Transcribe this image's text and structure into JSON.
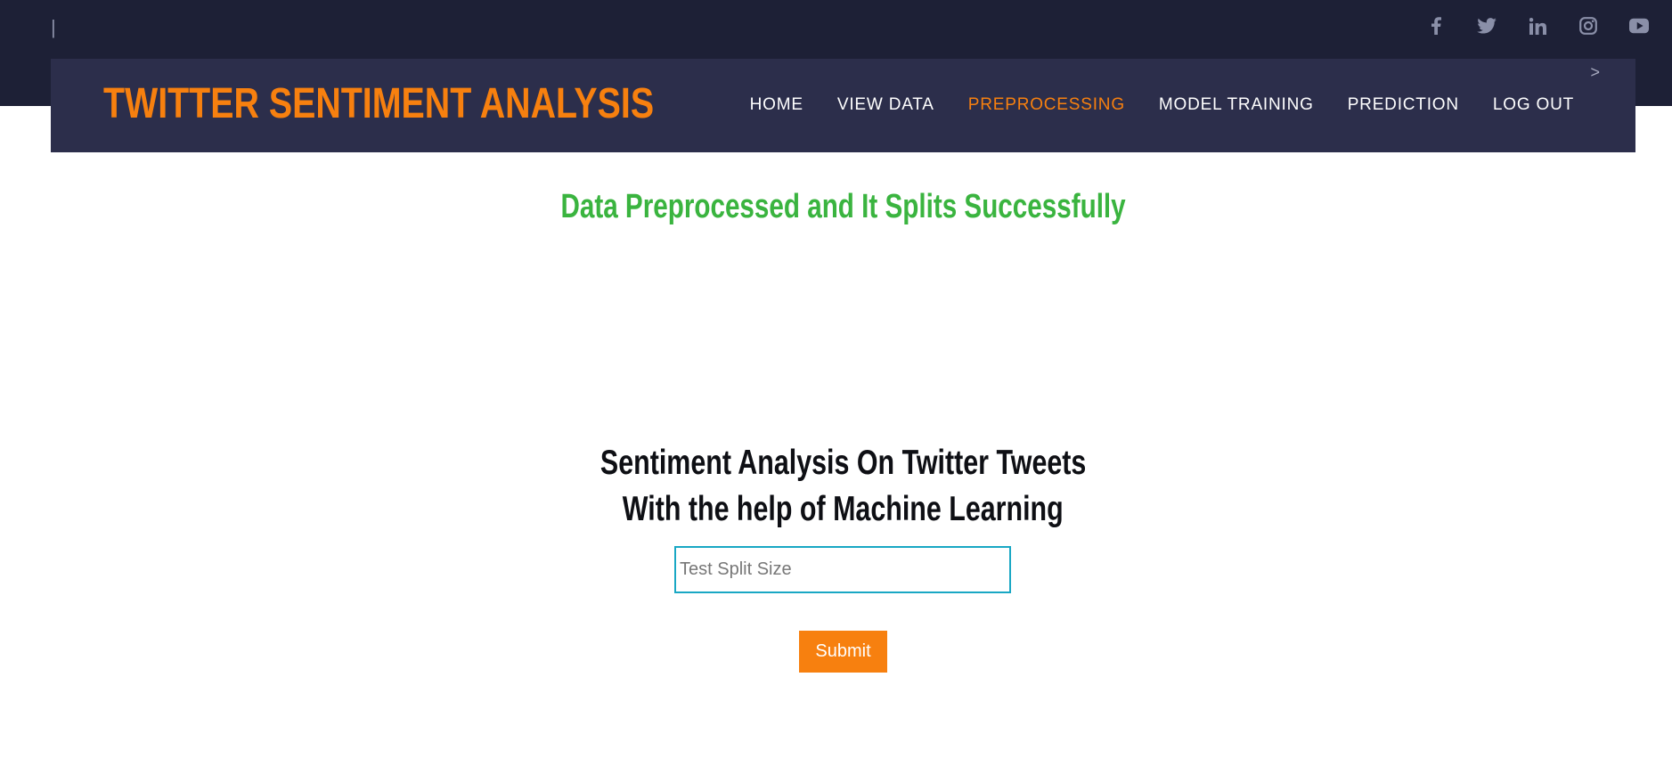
{
  "topbar": {
    "divider": "|",
    "social": [
      {
        "icon": "facebook-icon"
      },
      {
        "icon": "twitter-icon"
      },
      {
        "icon": "linkedin-icon"
      },
      {
        "icon": "instagram-icon"
      },
      {
        "icon": "youtube-icon"
      }
    ],
    "icon_color": "#8a8fa8"
  },
  "navbar": {
    "brand": "TWITTER SENTIMENT ANALYSIS",
    "chevron": ">",
    "items": [
      {
        "label": "HOME"
      },
      {
        "label": "VIEW DATA"
      },
      {
        "label": "PREPROCESSING",
        "active": true
      },
      {
        "label": "MODEL TRAINING"
      },
      {
        "label": "PREDICTION"
      },
      {
        "label": "LOG OUT"
      }
    ],
    "accent": "#f7800f"
  },
  "main": {
    "success_message": "Data Preprocessed and It Splits Successfully",
    "heading_line1": "Sentiment Analysis On Twitter Tweets",
    "heading_line2": "With the help of Machine Learning",
    "input": {
      "value": "",
      "placeholder": "Test Split Size"
    },
    "submit_label": "Submit",
    "success_color": "#3ab43f"
  }
}
